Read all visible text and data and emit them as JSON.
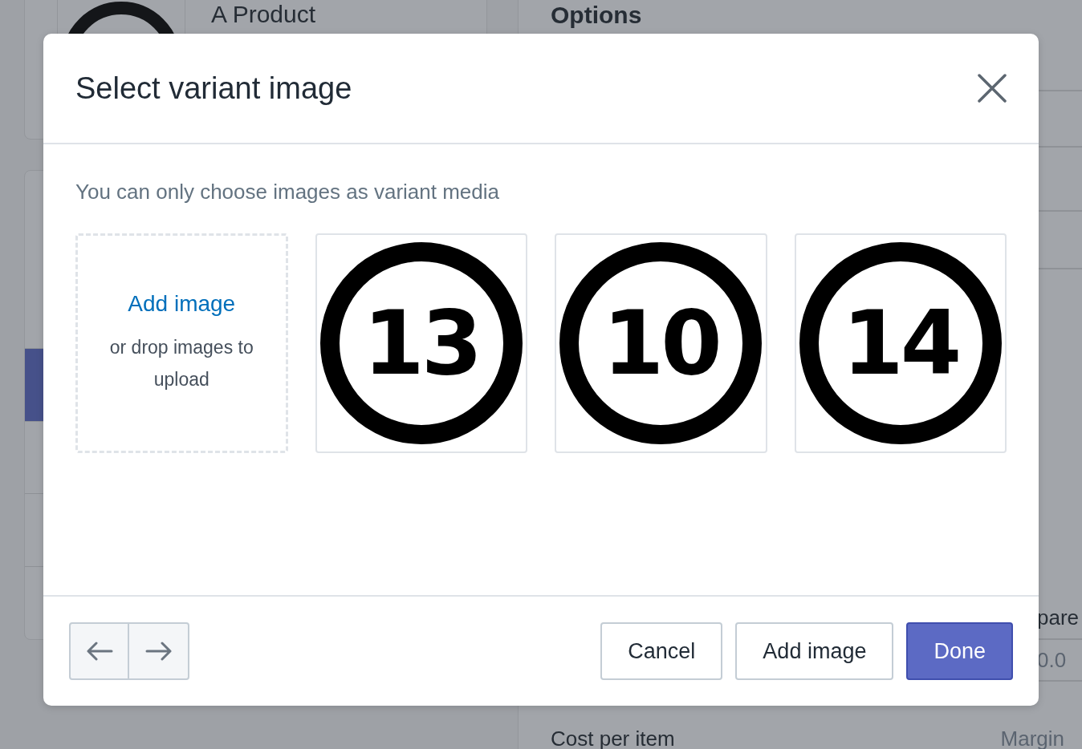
{
  "background": {
    "product_title": "A Product",
    "options_heading": "Options",
    "variant_list": [
      {
        "selected": false
      },
      {
        "selected": true
      },
      {
        "selected": false
      },
      {
        "selected": false
      },
      {
        "selected": false
      }
    ],
    "compare_label": "pare",
    "price_value": "0.0",
    "cost_label": "Cost per item",
    "margin_label": "Margin"
  },
  "modal": {
    "title": "Select variant image",
    "note": "You can only choose images as variant media",
    "upload": {
      "link": "Add image",
      "hint": "or drop images to upload"
    },
    "images": [
      {
        "number": "13"
      },
      {
        "number": "10"
      },
      {
        "number": "14"
      }
    ],
    "buttons": [
      {
        "label": "Cancel",
        "kind": "secondary"
      },
      {
        "label": "Add image",
        "kind": "secondary"
      },
      {
        "label": "Done",
        "kind": "primary"
      }
    ]
  }
}
